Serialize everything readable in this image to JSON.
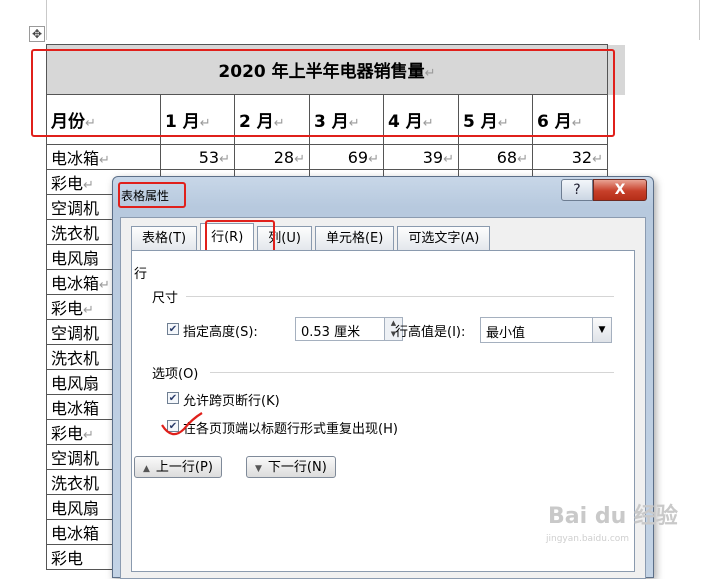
{
  "table": {
    "title": "2020 年上半年电器销售量",
    "header": [
      "月份",
      "1 月",
      "2 月",
      "3 月",
      "4 月",
      "5 月",
      "6 月"
    ],
    "rows": [
      {
        "name": "电冰箱",
        "values": [
          "53",
          "28",
          "69",
          "39",
          "68",
          "32"
        ]
      },
      {
        "name": "彩电",
        "values": [
          "",
          "",
          "",
          "",
          "",
          ""
        ]
      },
      {
        "name": "空调机",
        "values": [
          "",
          "",
          "",
          "",
          "",
          ""
        ]
      },
      {
        "name": "洗衣机",
        "values": [
          "",
          "",
          "",
          "",
          "",
          ""
        ]
      },
      {
        "name": "电风扇",
        "values": [
          "",
          "",
          "",
          "",
          "",
          ""
        ]
      },
      {
        "name": "电冰箱",
        "values": [
          "",
          "",
          "",
          "",
          "",
          ""
        ]
      },
      {
        "name": "彩电",
        "values": [
          "",
          "",
          "",
          "",
          "",
          ""
        ]
      },
      {
        "name": "空调机",
        "values": [
          "",
          "",
          "",
          "",
          "",
          ""
        ]
      },
      {
        "name": "洗衣机",
        "values": [
          "",
          "",
          "",
          "",
          "",
          ""
        ]
      },
      {
        "name": "电风扇",
        "values": [
          "",
          "",
          "",
          "",
          "",
          ""
        ]
      },
      {
        "name": "电冰箱",
        "values": [
          "",
          "",
          "",
          "",
          "",
          ""
        ]
      },
      {
        "name": "彩电",
        "values": [
          "",
          "",
          "",
          "",
          "",
          ""
        ]
      },
      {
        "name": "空调机",
        "values": [
          "",
          "",
          "",
          "",
          "",
          ""
        ]
      },
      {
        "name": "洗衣机",
        "values": [
          "",
          "",
          "",
          "",
          "",
          ""
        ]
      },
      {
        "name": "电风扇",
        "values": [
          "",
          "",
          "",
          "",
          "",
          ""
        ]
      },
      {
        "name": "电冰箱",
        "values": [
          "",
          "",
          "",
          "",
          "",
          ""
        ]
      },
      {
        "name": "彩电",
        "values": [
          "",
          "",
          "",
          "",
          "",
          ""
        ]
      }
    ],
    "paragraph_mark": "↵"
  },
  "dialog": {
    "title": "表格属性",
    "help_label": "?",
    "close_label": "X",
    "tabs": [
      "表格(T)",
      "行(R)",
      "列(U)",
      "单元格(E)",
      "可选文字(A)"
    ],
    "active_tab": "行(R)",
    "section_row": "行",
    "size_label": "尺寸",
    "specify_height_label": "指定高度(S):",
    "specify_height_checked": true,
    "height_value": "0.53 厘米",
    "row_height_is_label": "行高值是(I):",
    "row_height_is_value": "最小值",
    "options_label": "选项(O)",
    "allow_break_label": "允许跨页断行(K)",
    "allow_break_checked": true,
    "repeat_header_label": "在各页顶端以标题行形式重复出现(H)",
    "repeat_header_checked": true,
    "prev_row_label": "上一行(P)",
    "next_row_label": "下一行(N)"
  },
  "colors": {
    "highlight_red": "#e0201b",
    "title_row_bg": "#d7d7d7"
  },
  "watermark": {
    "brand": "Bai du 经验",
    "url": "jingyan.baidu.com"
  }
}
